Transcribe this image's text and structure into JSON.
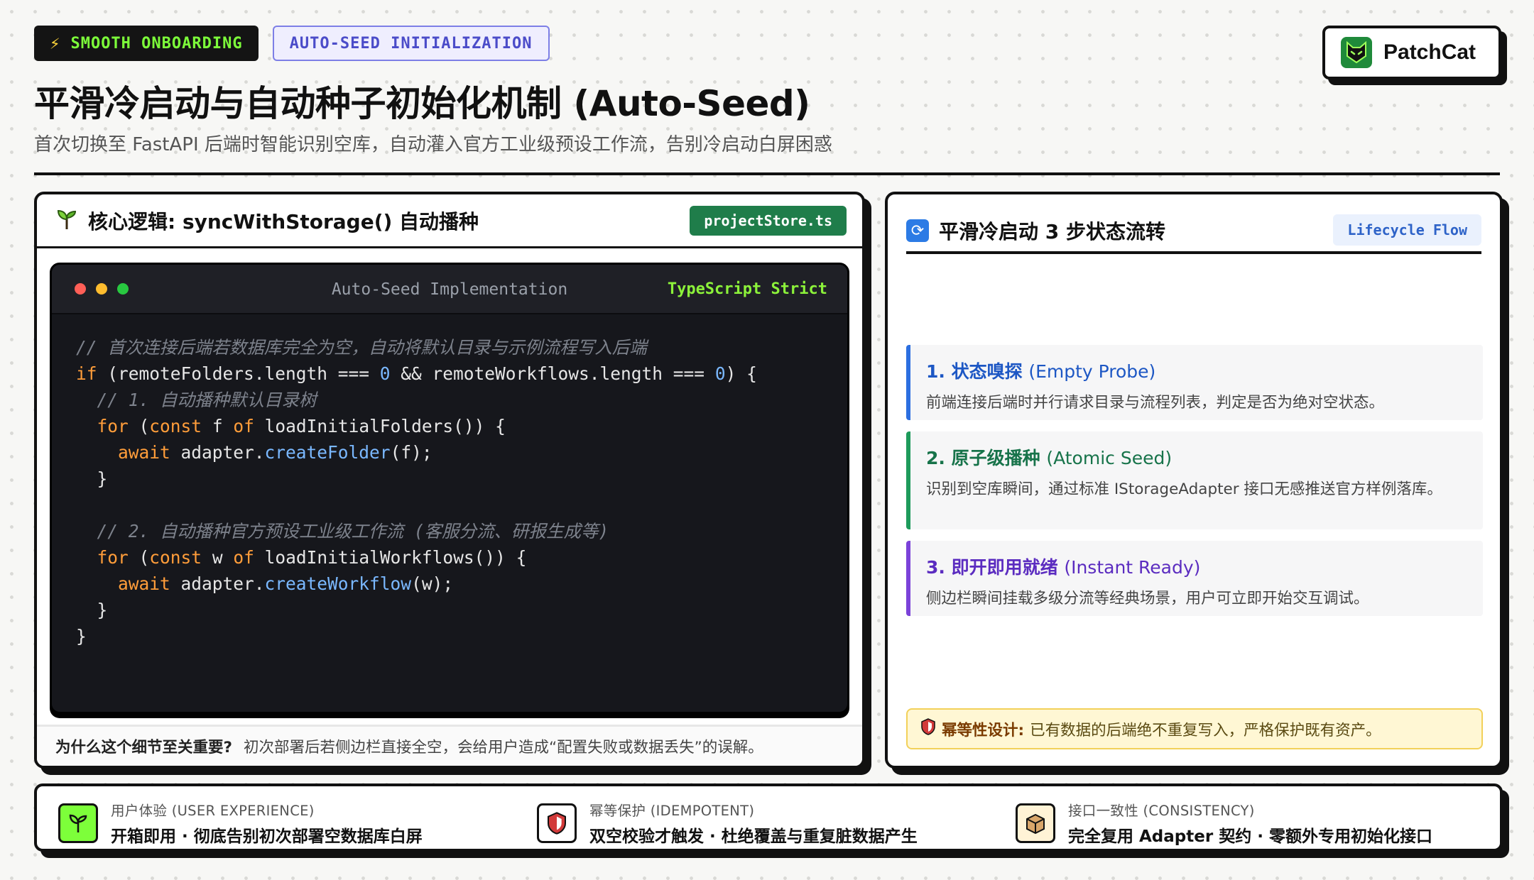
{
  "header": {
    "badge_primary": "SMOOTH ONBOARDING",
    "badge_secondary": "AUTO-SEED INITIALIZATION",
    "title": "平滑冷启动与自动种子初始化机制 (Auto-Seed)",
    "subtitle": "首次切换至 FastAPI 后端时智能识别空库，自动灌入官方工业级预设工作流，告别冷启动白屏困惑",
    "brand": "PatchCat"
  },
  "left_card": {
    "title": "核心逻辑: syncWithStorage() 自动播种",
    "file_tag": "projectStore.ts",
    "editor": {
      "title": "Auto-Seed Implementation",
      "language": "TypeScript Strict"
    },
    "footer_label": "为什么这个细节至关重要?",
    "footer_text": "初次部署后若侧边栏直接全空，会给用户造成“配置失败或数据丢失”的误解。"
  },
  "right_card": {
    "title": "平滑冷启动 3 步状态流转",
    "tag": "Lifecycle Flow",
    "steps": [
      {
        "title": "1. 状态嗅探",
        "title_en": "(Empty Probe)",
        "desc": "前端连接后端时并行请求目录与流程列表，判定是否为绝对空状态。"
      },
      {
        "title": "2. 原子级播种",
        "title_en": "(Atomic Seed)",
        "desc": "识别到空库瞬间，通过标准 IStorageAdapter 接口无感推送官方样例落库。"
      },
      {
        "title": "3. 即开即用就绪",
        "title_en": "(Instant Ready)",
        "desc": "侧边栏瞬间挂载多级分流等经典场景，用户可立即开始交互调试。"
      }
    ],
    "note_label": "幂等性设计:",
    "note_text": "已有数据的后端绝不重复写入，严格保护既有资产。"
  },
  "features": [
    {
      "label": "用户体验 (USER EXPERIENCE)",
      "text": "开箱即用 · 彻底告别初次部署空数据库白屏",
      "icon": "sprout-icon"
    },
    {
      "label": "幂等保护 (IDEMPOTENT)",
      "text": "双空校验才触发 · 杜绝覆盖与重复脏数据产生",
      "icon": "shield-icon"
    },
    {
      "label": "接口一致性 (CONSISTENCY)",
      "text": "完全复用 Adapter 契约 · 零额外专用初始化接口",
      "icon": "package-icon"
    }
  ],
  "colors": {
    "accent_green": "#1f7d4a",
    "lime": "#7dff3a",
    "step_blue": "#2c6fe0",
    "step_green": "#1e9b5b",
    "step_purple": "#7b42d9"
  }
}
